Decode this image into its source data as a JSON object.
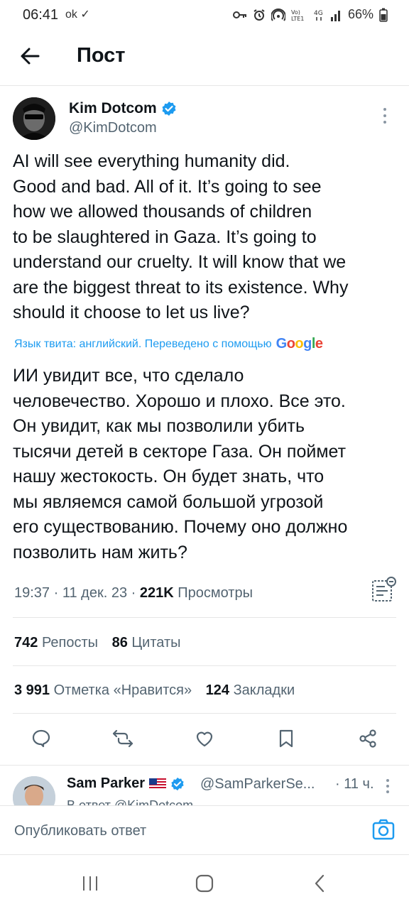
{
  "status_bar": {
    "time": "06:41",
    "left_icons": "ok ✓",
    "battery": "66%"
  },
  "header": {
    "title": "Пост"
  },
  "post": {
    "author_name": "Kim Dotcom",
    "author_handle": "@KimDotcom",
    "text": "AI will see everything humanity did.\nGood and bad. All of it. It’s going to see\nhow we allowed thousands of children\nto be slaughtered in Gaza. It’s going to\nunderstand our cruelty. It will know that we\nare the biggest threat to its existence. Why\nshould it choose to let us live?",
    "translation_note": "Язык твита: английский. Переведено с помощью",
    "translation_provider": "Google",
    "translated_text": "ИИ увидит все, что сделало\nчеловечество. Хорошо и плохо. Все это.\nОн увидит, как мы позволили убить\nтысячи детей в секторе Газа. Он поймет\nнашу жестокость. Он будет знать, что\nмы являемся самой большой угрозой\nего существованию. Почему оно должно\nпозволить нам жить?",
    "time": "19:37",
    "date": "11 дек. 23",
    "views_count": "221K",
    "views_label": "Просмотры",
    "reposts_count": "742",
    "reposts_label": "Репосты",
    "quotes_count": "86",
    "quotes_label": "Цитаты",
    "likes_count": "3 991",
    "likes_label": "Отметка «Нравится»",
    "bookmarks_count": "124",
    "bookmarks_label": "Закладки"
  },
  "reply": {
    "author_name": "Sam Parker",
    "flag": "🇺🇸",
    "author_handle": "@SamParkerSe...",
    "time": "· 11 ч.",
    "in_reply_to": "В ответ @KimDotcom"
  },
  "composer": {
    "placeholder": "Опубликовать ответ"
  },
  "colors": {
    "accent": "#1d9bf0",
    "text": "#0f1419",
    "secondary": "#536471"
  }
}
